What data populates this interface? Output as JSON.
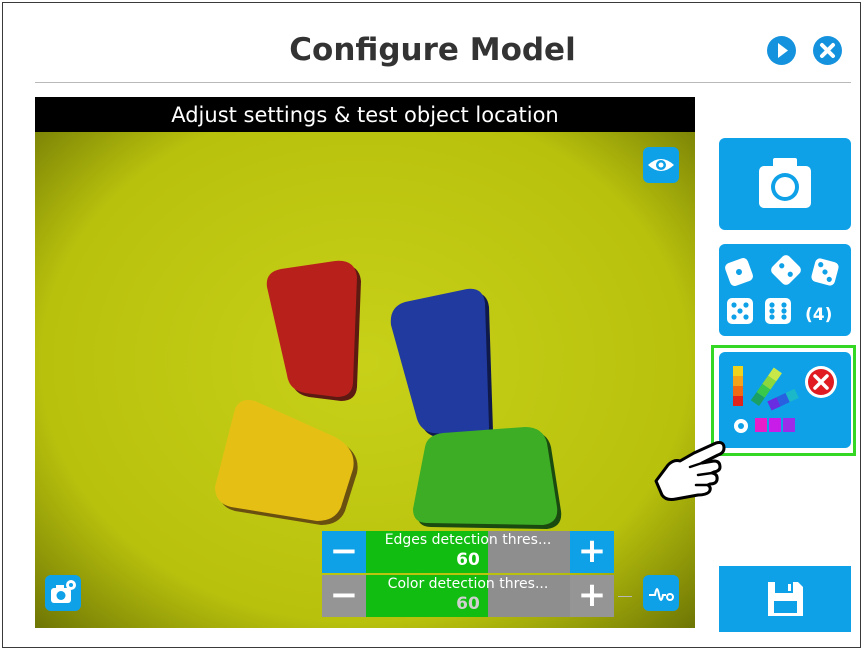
{
  "header": {
    "title": "Configure Model",
    "play_icon": "play-icon",
    "close_icon": "close-icon"
  },
  "camera_view": {
    "caption": "Adjust settings & test object location",
    "background_color": "#bcc50e",
    "objects": [
      {
        "color_name": "red",
        "color": "#b8201c"
      },
      {
        "color_name": "blue",
        "color": "#203aa0"
      },
      {
        "color_name": "yellow",
        "color": "#e6bf14"
      },
      {
        "color_name": "green",
        "color": "#3cad24"
      }
    ]
  },
  "controls": {
    "edges": {
      "label": "Edges detection thres...",
      "value": "60",
      "fraction": 0.6,
      "minus_label": "−",
      "plus_label": "+"
    },
    "color": {
      "label": "Color detection thres...",
      "value": "60",
      "fraction": 0.6,
      "minus_label": "−",
      "plus_label": "+"
    }
  },
  "sidebar": {
    "capture_icon": "camera-icon",
    "dice_count": "(4)",
    "palette_icon": "color-palette-icon",
    "save_icon": "floppy-disk-icon"
  },
  "colors": {
    "accent": "#0ea1e8",
    "highlight": "#34d824",
    "error": "#e01b22",
    "disabled": "#959595",
    "fill": "#12bd12"
  }
}
